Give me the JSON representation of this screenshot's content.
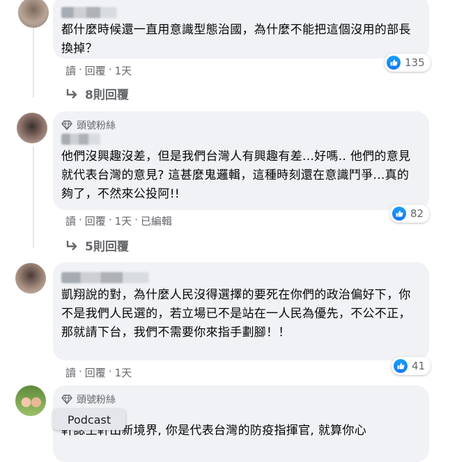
{
  "comments": [
    {
      "text": "都什麼時候還一直用意識型態治國，為什麼不能把這個沒用的部長換掉？",
      "reactions": "135",
      "actions": [
        "讀",
        "回覆",
        "1天"
      ],
      "replies": "8則回覆"
    },
    {
      "badge": "頭號粉絲",
      "text": "他們沒興趣沒差，但是我們台灣人有興趣有差...好嗎.. 他們的意見就代表台灣的意見? 這甚麼鬼邏輯，這種時刻還在意識鬥爭...真的夠了，不然來公投阿!!",
      "reactions": "82",
      "actions": [
        "讀",
        "回覆",
        "1天",
        "已編輯"
      ],
      "replies": "5則回覆"
    },
    {
      "text": "凱翔說的對，為什麼人民沒得選擇的要死在你們的政治偏好下，你不是我們人民選的，若立場已不是站在一人民為優先，不公不正，那就請下台，我們不需要你來指手劃腳！！",
      "reactions": "41",
      "actions": [
        "讀",
        "回覆",
        "1天"
      ]
    },
    {
      "badge": "頭號粉絲",
      "text": "軒誌王軒出新境界, 你是代表台灣的防疫指揮官, 就算你心"
    }
  ],
  "tooltip": "Podcast",
  "colors": {
    "bubble": "#f0f2f5",
    "like_blue": "#1877f2",
    "meta_gray": "#65676b"
  }
}
